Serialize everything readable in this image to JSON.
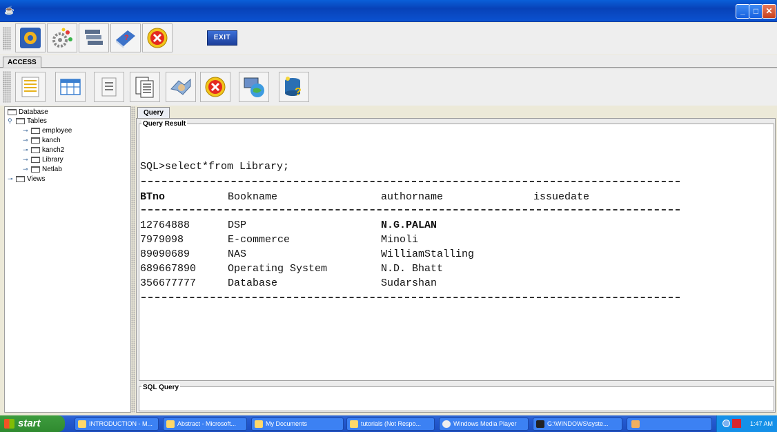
{
  "window": {
    "controls": {
      "minimize": "_",
      "maximize": "□",
      "close": "✕"
    }
  },
  "toolbar1": {
    "icons": [
      "database-settings-icon",
      "settings-gears-icon",
      "stack-icon",
      "book-help-icon",
      "cancel-icon"
    ],
    "exit_label": "EXIT"
  },
  "tabs": {
    "access": "ACCESS"
  },
  "toolbar2": {
    "icons": [
      "list-icon",
      "table-icon",
      "document-icon",
      "pages-icon",
      "handshake-icon",
      "cancel-icon",
      "network-globe-icon",
      "database-help-icon"
    ]
  },
  "tree": {
    "root": "Database",
    "tables_label": "Tables",
    "tables": [
      "employee",
      "kanch",
      "kanch2",
      "Library",
      "Netlab"
    ],
    "views_label": "Views"
  },
  "query": {
    "tab_label": "Query",
    "result_title": "Query Result",
    "sql_statement": "SQL>select*from Library;",
    "columns": [
      "BTno",
      "Bookname",
      "authorname",
      "issuedate"
    ],
    "rows": [
      [
        "12764888",
        "DSP",
        "N.G.PALAN",
        ""
      ],
      [
        "7979098",
        "E-commerce",
        "Minoli",
        ""
      ],
      [
        "89090689",
        "NAS",
        "WilliamStalling",
        ""
      ],
      [
        "689667890",
        "Operating System",
        "N.D. Bhatt",
        ""
      ],
      [
        "356677777",
        "Database",
        "Sudarshan",
        ""
      ]
    ],
    "sql_query_title": "SQL Query"
  },
  "taskbar": {
    "start_label": "start",
    "tasks": [
      "INTRODUCTION - M...",
      "Abstract - Microsoft...",
      "My Documents",
      "tutorials (Not Respo...",
      "Windows Media Player",
      "G:\\WINDOWS\\syste..."
    ],
    "clock": "1:47 AM"
  }
}
